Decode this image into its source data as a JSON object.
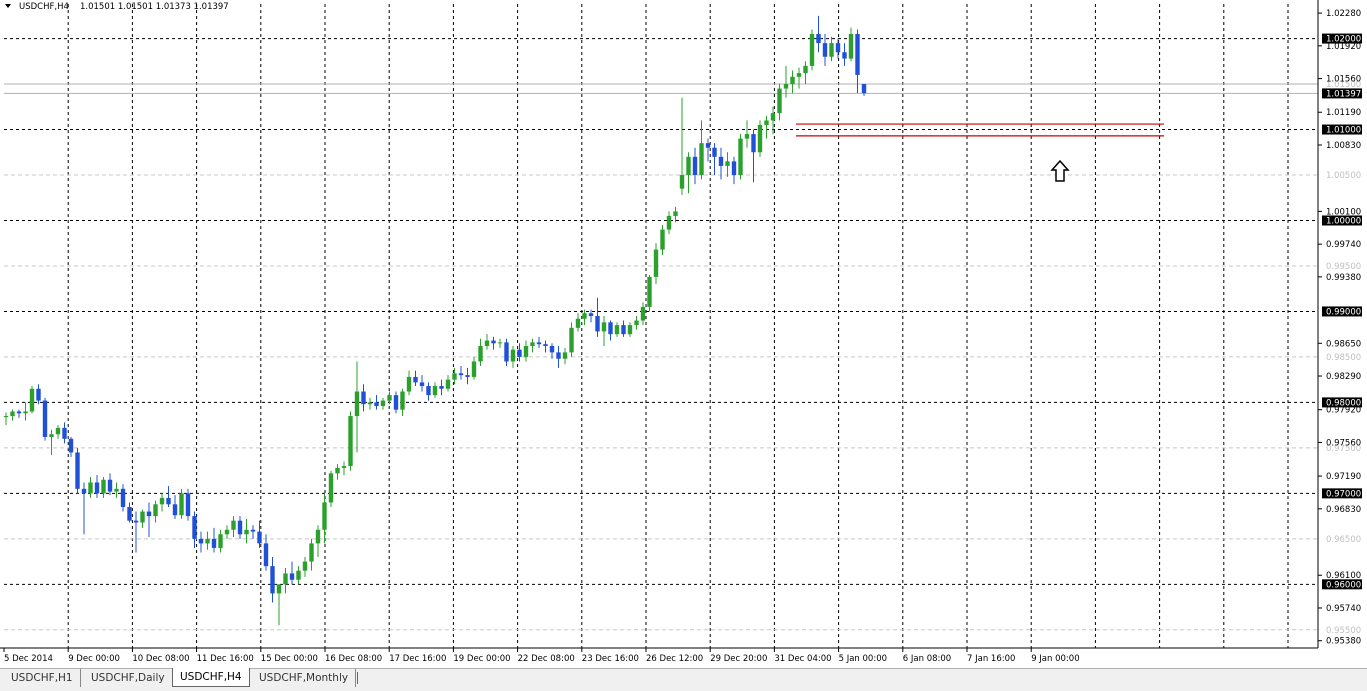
{
  "header": {
    "symbol": "USDCHF,H4",
    "ohlc": "1.01501 1.01501 1.01373 1.01397"
  },
  "tabs": [
    {
      "label": "USDCHF,H1",
      "active": false
    },
    {
      "label": "USDCHF,Daily",
      "active": false
    },
    {
      "label": "USDCHF,H4",
      "active": true
    },
    {
      "label": "USDCHF,Monthly",
      "active": false
    }
  ],
  "colors": {
    "bull": "#2ca02c",
    "bear": "#2150d8",
    "wick_bull": "#2ca02c",
    "wick_bear": "#2150d8",
    "grid": "#000000",
    "resistance": "#cc0000"
  },
  "chart_data": {
    "type": "candlestick",
    "x_tick_labels": [
      "5 Dec 2014",
      "9 Dec 00:00",
      "10 Dec 08:00",
      "11 Dec 16:00",
      "15 Dec 00:00",
      "16 Dec 08:00",
      "17 Dec 16:00",
      "19 Dec 00:00",
      "22 Dec 08:00",
      "23 Dec 16:00",
      "26 Dec 12:00",
      "29 Dec 20:00",
      "31 Dec 04:00",
      "5 Jan 00:00",
      "6 Jan 08:00",
      "7 Jan 16:00",
      "9 Jan 00:00"
    ],
    "y_range": [
      0.953,
      1.0238
    ],
    "y_tick_labels": [
      "1.02280",
      "1.01920",
      "1.01560",
      "1.01190",
      "1.00830",
      "1.00100",
      "0.99740",
      "0.99380",
      "0.98650",
      "0.98290",
      "0.97920",
      "0.97560",
      "0.97190",
      "0.96830",
      "0.96100",
      "0.95740",
      "0.95380"
    ],
    "y_tick_values": [
      1.0228,
      1.0192,
      1.0156,
      1.0119,
      1.0083,
      1.001,
      0.9974,
      0.9938,
      0.9865,
      0.9829,
      0.9792,
      0.9756,
      0.9719,
      0.9683,
      0.961,
      0.9574,
      0.9538
    ],
    "round_levels": [
      1.02,
      1.01,
      1.0,
      0.99,
      0.98,
      0.97,
      0.96
    ],
    "round_level_labels": [
      "1.02000",
      "1.01000",
      "1.00000",
      "0.99000",
      "0.98000",
      "0.97000",
      "0.96000"
    ],
    "half_levels": [
      1.015,
      1.005,
      0.995,
      0.985,
      0.975,
      0.965,
      0.955
    ],
    "half_level_labels": [
      "1.01500",
      "1.00500",
      "0.99500",
      "0.98500",
      "0.97500",
      "0.96500",
      "0.95500"
    ],
    "current_price": 1.01397,
    "current_price_label": "1.01397",
    "resistance_lines": [
      1.0106,
      1.0093
    ],
    "grid": true,
    "candles": [
      [
        0.9785,
        0.9789,
        0.9775,
        0.9785
      ],
      [
        0.9785,
        0.9792,
        0.978,
        0.979
      ],
      [
        0.979,
        0.9792,
        0.9783,
        0.9788
      ],
      [
        0.9788,
        0.98,
        0.978,
        0.979
      ],
      [
        0.979,
        0.9818,
        0.9788,
        0.9815
      ],
      [
        0.9815,
        0.982,
        0.9798,
        0.9802
      ],
      [
        0.9802,
        0.9805,
        0.9758,
        0.9762
      ],
      [
        0.9762,
        0.977,
        0.9742,
        0.9765
      ],
      [
        0.9765,
        0.9775,
        0.976,
        0.9772
      ],
      [
        0.9772,
        0.9778,
        0.9755,
        0.976
      ],
      [
        0.976,
        0.9762,
        0.974,
        0.9745
      ],
      [
        0.9745,
        0.975,
        0.97,
        0.9705
      ],
      [
        0.9705,
        0.9712,
        0.9655,
        0.97
      ],
      [
        0.97,
        0.9718,
        0.9695,
        0.9712
      ],
      [
        0.9712,
        0.972,
        0.9695,
        0.97
      ],
      [
        0.97,
        0.9718,
        0.9695,
        0.9715
      ],
      [
        0.9715,
        0.9722,
        0.9698,
        0.9702
      ],
      [
        0.9702,
        0.9712,
        0.9695,
        0.9705
      ],
      [
        0.9705,
        0.971,
        0.968,
        0.9685
      ],
      [
        0.9685,
        0.969,
        0.9668,
        0.967
      ],
      [
        0.967,
        0.968,
        0.9635,
        0.9668
      ],
      [
        0.9668,
        0.9682,
        0.9662,
        0.968
      ],
      [
        0.968,
        0.969,
        0.9652,
        0.9675
      ],
      [
        0.9675,
        0.9692,
        0.9668,
        0.9688
      ],
      [
        0.9688,
        0.97,
        0.968,
        0.9695
      ],
      [
        0.9695,
        0.9708,
        0.9685,
        0.9688
      ],
      [
        0.9688,
        0.9698,
        0.9672,
        0.9676
      ],
      [
        0.9676,
        0.9705,
        0.9672,
        0.97
      ],
      [
        0.97,
        0.9705,
        0.967,
        0.9675
      ],
      [
        0.9675,
        0.968,
        0.964,
        0.965
      ],
      [
        0.965,
        0.9658,
        0.9635,
        0.9645
      ],
      [
        0.9645,
        0.9658,
        0.9638,
        0.965
      ],
      [
        0.965,
        0.9662,
        0.9635,
        0.964
      ],
      [
        0.964,
        0.966,
        0.9635,
        0.9655
      ],
      [
        0.9655,
        0.9665,
        0.965,
        0.966
      ],
      [
        0.966,
        0.9675,
        0.9652,
        0.967
      ],
      [
        0.967,
        0.9675,
        0.965,
        0.9655
      ],
      [
        0.9655,
        0.9672,
        0.9645,
        0.966
      ],
      [
        0.966,
        0.9665,
        0.965,
        0.9658
      ],
      [
        0.9658,
        0.967,
        0.964,
        0.9645
      ],
      [
        0.9645,
        0.9655,
        0.9615,
        0.962
      ],
      [
        0.962,
        0.963,
        0.958,
        0.959
      ],
      [
        0.959,
        0.96,
        0.9555,
        0.96
      ],
      [
        0.96,
        0.9618,
        0.959,
        0.9612
      ],
      [
        0.9612,
        0.9625,
        0.96,
        0.9605
      ],
      [
        0.9605,
        0.962,
        0.96,
        0.9615
      ],
      [
        0.9615,
        0.963,
        0.9608,
        0.9625
      ],
      [
        0.9625,
        0.965,
        0.9615,
        0.9645
      ],
      [
        0.9645,
        0.9665,
        0.963,
        0.966
      ],
      [
        0.966,
        0.97,
        0.9645,
        0.969
      ],
      [
        0.969,
        0.9725,
        0.9685,
        0.9722
      ],
      [
        0.9722,
        0.9732,
        0.9715,
        0.9728
      ],
      [
        0.9728,
        0.9735,
        0.972,
        0.973
      ],
      [
        0.973,
        0.979,
        0.9725,
        0.9785
      ],
      [
        0.9785,
        0.9845,
        0.9745,
        0.9812
      ],
      [
        0.9812,
        0.982,
        0.979,
        0.9798
      ],
      [
        0.9798,
        0.9805,
        0.9792,
        0.98
      ],
      [
        0.98,
        0.9808,
        0.9792,
        0.9796
      ],
      [
        0.9796,
        0.9805,
        0.9792,
        0.9802
      ],
      [
        0.9802,
        0.9812,
        0.9798,
        0.9808
      ],
      [
        0.9808,
        0.9812,
        0.9788,
        0.9792
      ],
      [
        0.9792,
        0.9815,
        0.9785,
        0.9812
      ],
      [
        0.9812,
        0.9835,
        0.9808,
        0.9828
      ],
      [
        0.9828,
        0.9835,
        0.9818,
        0.9822
      ],
      [
        0.9822,
        0.983,
        0.9812,
        0.9818
      ],
      [
        0.9818,
        0.9822,
        0.9802,
        0.9808
      ],
      [
        0.9808,
        0.9822,
        0.9805,
        0.9818
      ],
      [
        0.9818,
        0.9825,
        0.9808,
        0.9815
      ],
      [
        0.9815,
        0.983,
        0.9812,
        0.9825
      ],
      [
        0.9825,
        0.9838,
        0.982,
        0.9832
      ],
      [
        0.9832,
        0.984,
        0.9825,
        0.983
      ],
      [
        0.983,
        0.9838,
        0.982,
        0.9828
      ],
      [
        0.9828,
        0.985,
        0.9825,
        0.9845
      ],
      [
        0.9845,
        0.987,
        0.984,
        0.9862
      ],
      [
        0.9862,
        0.9875,
        0.9858,
        0.9868
      ],
      [
        0.9868,
        0.9872,
        0.9858,
        0.9865
      ],
      [
        0.9865,
        0.987,
        0.986,
        0.9866
      ],
      [
        0.9866,
        0.987,
        0.984,
        0.9845
      ],
      [
        0.9845,
        0.9862,
        0.9838,
        0.9858
      ],
      [
        0.9858,
        0.9865,
        0.9845,
        0.985
      ],
      [
        0.985,
        0.9868,
        0.9845,
        0.9862
      ],
      [
        0.9862,
        0.987,
        0.9855,
        0.9866
      ],
      [
        0.9866,
        0.9872,
        0.986,
        0.9864
      ],
      [
        0.9864,
        0.9868,
        0.9855,
        0.9862
      ],
      [
        0.9862,
        0.9865,
        0.9848,
        0.9855
      ],
      [
        0.9855,
        0.9862,
        0.9838,
        0.9848
      ],
      [
        0.9848,
        0.986,
        0.9842,
        0.9855
      ],
      [
        0.9855,
        0.9888,
        0.985,
        0.9882
      ],
      [
        0.9882,
        0.9898,
        0.9878,
        0.9892
      ],
      [
        0.9892,
        0.9902,
        0.9885,
        0.9898
      ],
      [
        0.9898,
        0.9902,
        0.9888,
        0.9895
      ],
      [
        0.9895,
        0.9915,
        0.9872,
        0.9878
      ],
      [
        0.9878,
        0.9895,
        0.9862,
        0.9888
      ],
      [
        0.9888,
        0.989,
        0.9868,
        0.9875
      ],
      [
        0.9875,
        0.9888,
        0.9872,
        0.9885
      ],
      [
        0.9885,
        0.989,
        0.9872,
        0.9875
      ],
      [
        0.9875,
        0.9888,
        0.9872,
        0.9885
      ],
      [
        0.9885,
        0.9895,
        0.988,
        0.989
      ],
      [
        0.989,
        0.991,
        0.9885,
        0.9905
      ],
      [
        0.9905,
        0.994,
        0.99,
        0.9938
      ],
      [
        0.9938,
        0.9975,
        0.993,
        0.9968
      ],
      [
        0.9968,
        0.9995,
        0.9962,
        0.999
      ],
      [
        0.999,
        1.001,
        0.9985,
        1.0005
      ],
      [
        1.0005,
        1.0015,
        0.9998,
        1.001
      ],
      [
        1.0035,
        1.0135,
        1.0028,
        1.005
      ],
      [
        1.005,
        1.0075,
        1.003,
        1.007
      ],
      [
        1.007,
        1.008,
        1.004,
        1.005
      ],
      [
        1.005,
        1.011,
        1.0045,
        1.0085
      ],
      [
        1.0085,
        1.009,
        1.0065,
        1.008
      ],
      [
        1.008,
        1.0085,
        1.005,
        1.007
      ],
      [
        1.007,
        1.008,
        1.0045,
        1.006
      ],
      [
        1.006,
        1.0075,
        1.0048,
        1.0065
      ],
      [
        1.0065,
        1.007,
        1.004,
        1.005
      ],
      [
        1.005,
        1.0095,
        1.0045,
        1.009
      ],
      [
        1.009,
        1.011,
        1.008,
        1.0095
      ],
      [
        1.0095,
        1.01,
        1.0042,
        1.0075
      ],
      [
        1.0075,
        1.011,
        1.007,
        1.0105
      ],
      [
        1.0105,
        1.0115,
        1.009,
        1.011
      ],
      [
        1.011,
        1.0125,
        1.0095,
        1.0118
      ],
      [
        1.0118,
        1.015,
        1.011,
        1.0145
      ],
      [
        1.0145,
        1.017,
        1.0135,
        1.015
      ],
      [
        1.015,
        1.0165,
        1.014,
        1.0158
      ],
      [
        1.0158,
        1.0168,
        1.0145,
        1.0162
      ],
      [
        1.0162,
        1.0175,
        1.015,
        1.017
      ],
      [
        1.017,
        1.021,
        1.0165,
        1.0205
      ],
      [
        1.0205,
        1.0225,
        1.0185,
        1.0195
      ],
      [
        1.0195,
        1.0205,
        1.017,
        1.018
      ],
      [
        1.018,
        1.0202,
        1.0175,
        1.0195
      ],
      [
        1.0195,
        1.02,
        1.0178,
        1.0185
      ],
      [
        1.0185,
        1.0195,
        1.017,
        1.0178
      ],
      [
        1.0178,
        1.0212,
        1.0175,
        1.0205
      ],
      [
        1.0205,
        1.021,
        1.014,
        1.016
      ],
      [
        1.015,
        1.015,
        1.0137,
        1.014
      ]
    ]
  }
}
